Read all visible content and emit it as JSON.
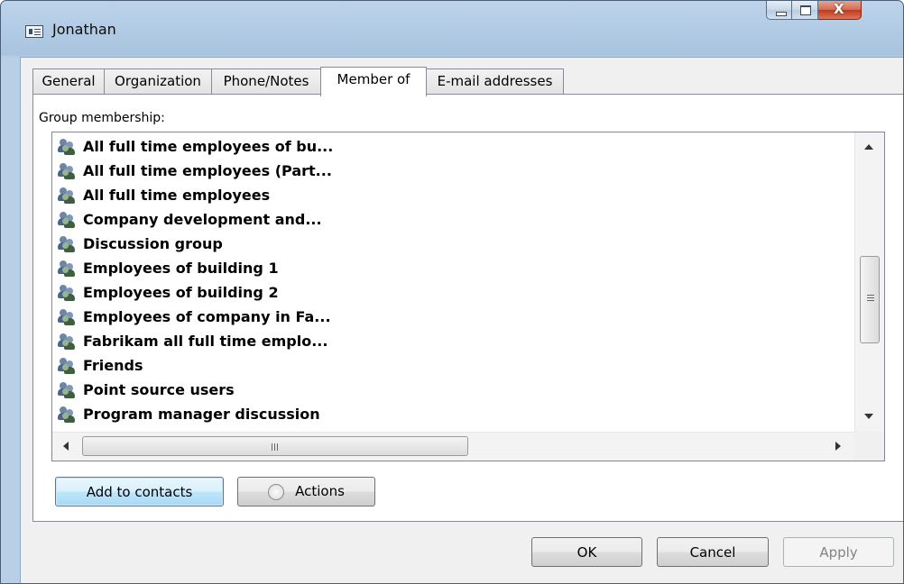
{
  "window": {
    "title": "Jonathan",
    "icon": "contact-card-icon"
  },
  "tabs": [
    {
      "label": "General",
      "active": false
    },
    {
      "label": "Organization",
      "active": false
    },
    {
      "label": "Phone/Notes",
      "active": false
    },
    {
      "label": "Member of",
      "active": true
    },
    {
      "label": "E-mail addresses",
      "active": false
    }
  ],
  "member_of": {
    "group_label": "Group membership:",
    "groups": [
      "All full time employees of bu...",
      "All full time employees (Part...",
      "All full time employees",
      "Company development and...",
      "Discussion group",
      "Employees of building  1",
      "Employees of building  2",
      "Employees of company in Fa...",
      "Fabrikam all full time emplo...",
      "Friends",
      "Point source users",
      "Program manager  discussion"
    ],
    "add_button": "Add to contacts",
    "actions_button": "Actions"
  },
  "footer": {
    "ok": "OK",
    "cancel": "Cancel",
    "apply": "Apply"
  }
}
